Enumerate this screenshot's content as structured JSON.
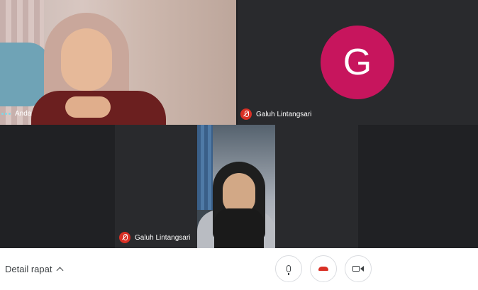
{
  "participants": {
    "self": {
      "label": "Anda"
    },
    "avatar_tile": {
      "name": "Galuh Lintangsari",
      "initial": "G",
      "avatar_color": "#c7155d"
    },
    "video_tile": {
      "name": "Galuh Lintangsari"
    }
  },
  "bottom_bar": {
    "meeting_details_label": "Detail rapat",
    "controls": [
      {
        "icon": "microphone-icon"
      },
      {
        "icon": "end-call-icon",
        "color": "#d93025"
      },
      {
        "icon": "camera-icon"
      }
    ]
  }
}
